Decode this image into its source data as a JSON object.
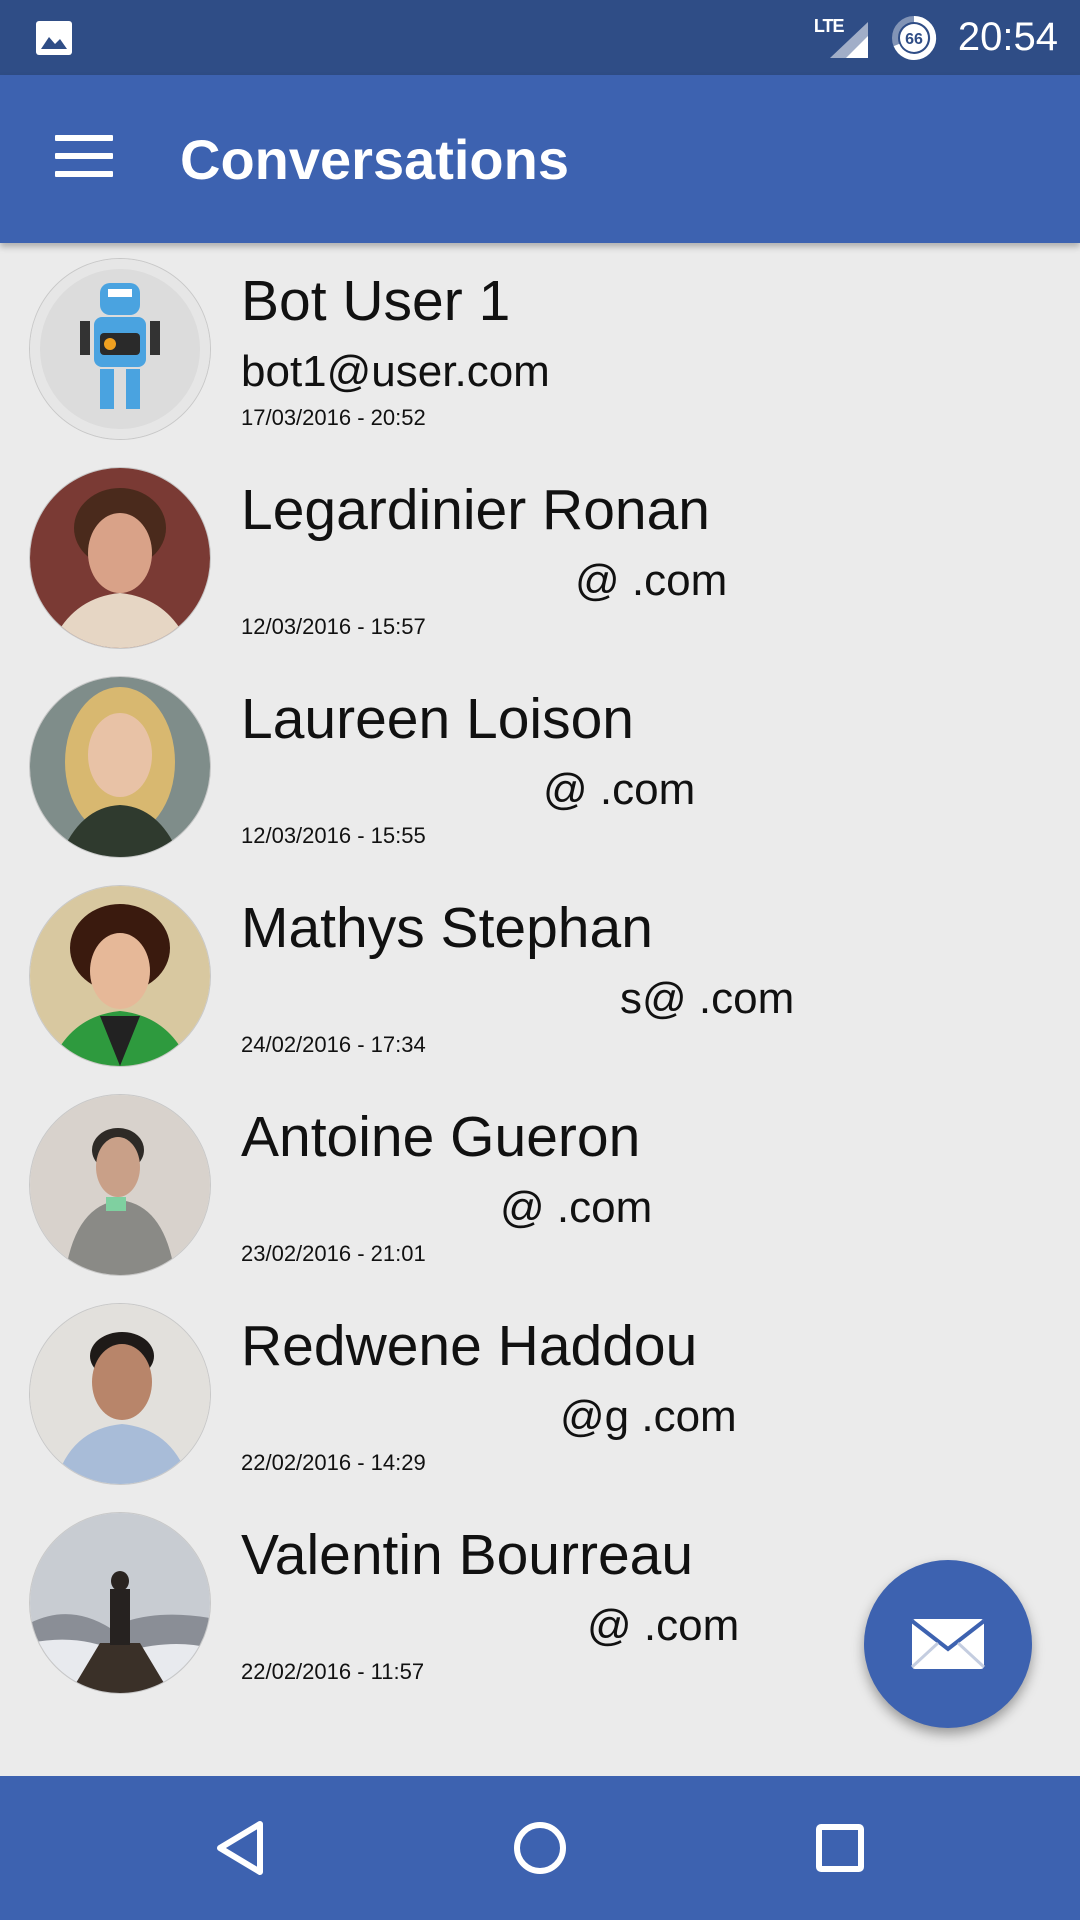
{
  "status_bar": {
    "network": "LTE",
    "battery_level": "66",
    "time": "20:54"
  },
  "app_bar": {
    "title": "Conversations"
  },
  "conversations": [
    {
      "name": "Bot User 1",
      "email": "bot1@user.com",
      "date": "17/03/2016 - 20:52"
    },
    {
      "name": "Legardinier Ronan",
      "email": "@     .com",
      "date": "12/03/2016 - 15:57"
    },
    {
      "name": "Laureen Loison",
      "email": "@     .com",
      "date": "12/03/2016 - 15:55"
    },
    {
      "name": "Mathys Stephan",
      "email": "s@     .com",
      "date": "24/02/2016 - 17:34"
    },
    {
      "name": "Antoine Gueron",
      "email": "@     .com",
      "date": "23/02/2016 - 21:01"
    },
    {
      "name": "Redwene Haddou",
      "email": "@g    .com",
      "date": "22/02/2016 - 14:29"
    },
    {
      "name": "Valentin Bourreau",
      "email": "@     .com",
      "date": "22/02/2016 - 11:57"
    }
  ],
  "colors": {
    "status_bar": "#2f4d86",
    "primary": "#3d62b0",
    "background": "#ebebeb"
  },
  "icons": {
    "status_image": "image-icon",
    "menu": "menu-icon",
    "fab": "envelope-icon",
    "nav_back": "back-triangle-icon",
    "nav_home": "home-circle-icon",
    "nav_recents": "recents-square-icon"
  }
}
